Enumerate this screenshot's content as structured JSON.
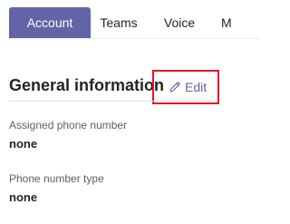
{
  "tabs": [
    {
      "label": "Account",
      "active": true
    },
    {
      "label": "Teams",
      "active": false
    },
    {
      "label": "Voice",
      "active": false
    },
    {
      "label": "M",
      "active": false
    }
  ],
  "section": {
    "title": "General information",
    "edit_label": "Edit",
    "edit_icon": "pencil-icon"
  },
  "fields": [
    {
      "label": "Assigned phone number",
      "value": "none"
    },
    {
      "label": "Phone number type",
      "value": "none"
    }
  ],
  "colors": {
    "accent": "#6264a7",
    "highlight_border": "#e81123",
    "text": "#252423",
    "muted_text": "#605e5c"
  }
}
